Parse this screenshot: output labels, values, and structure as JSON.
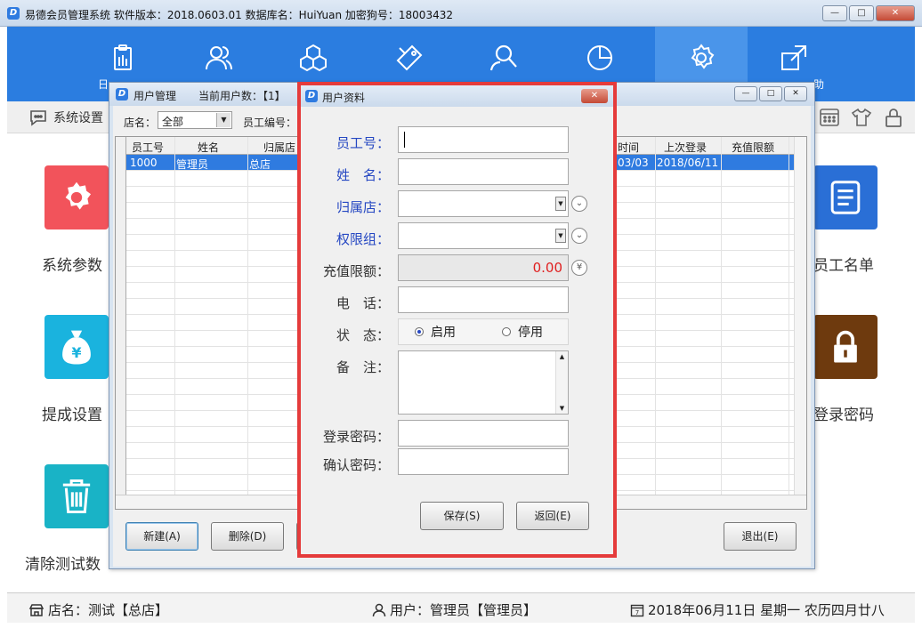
{
  "window": {
    "title": "易德会员管理系统   软件版本：2018.0603.01   数据库名：HuiYuan   加密狗号：18003432",
    "btn_min": "—",
    "btn_max": "□",
    "btn_close": "✕"
  },
  "nav": {
    "cut_label_left": "日",
    "cut_label_right": "助",
    "icons": [
      "clipboard-icon",
      "users-icon",
      "cubes-icon",
      "tag-icon",
      "search-person-icon",
      "pie-chart-icon",
      "gear-icon",
      "share-icon"
    ],
    "active_index": 6
  },
  "toolbar": {
    "system_settings": "系统设置"
  },
  "tiles": {
    "system_params": "系统参数",
    "commission": "提成设置",
    "clear_test": "清除测试数",
    "employee_list": "员工名单",
    "login_password": "登录密码",
    "colors": {
      "red": "#f2535b",
      "cyan": "#1ab3de",
      "teal": "#19b3c6",
      "blue": "#2a6fd6",
      "brown": "#6e3a0e"
    }
  },
  "status": {
    "store": "店名：测试【总店】",
    "user": "用户：管理员【管理员】",
    "date": "2018年06月11日 星期一 农历四月廿八"
  },
  "user_mgmt": {
    "title": "用户管理",
    "count": "当前用户数：【1】",
    "store_label": "店名：",
    "store_value": "全部",
    "employee_no_label": "员工编号：",
    "columns": {
      "emp_no": "员工号",
      "name": "姓名",
      "store": "归属店",
      "time": "时间",
      "last_login": "上次登录",
      "recharge_limit": "充值限额"
    },
    "row": {
      "emp_no": "1000",
      "name": "管理员",
      "store": "总店",
      "time": "03/03",
      "last_login": "2018/06/11",
      "recharge_limit": ""
    },
    "buttons": {
      "new": "新建(A)",
      "delete": "删除(D)",
      "exit": "退出(E)"
    }
  },
  "user_info": {
    "title": "用户资料",
    "labels": {
      "emp_no": "员工号：",
      "name": "姓　名：",
      "store": "归属店：",
      "permission": "权限组：",
      "limit": "充值限额：",
      "phone": "电　话：",
      "status": "状　态：",
      "remark": "备　注：",
      "login_pwd": "登录密码：",
      "confirm_pwd": "确认密码："
    },
    "values": {
      "emp_no": "",
      "name": "",
      "store": "",
      "permission": "",
      "limit": "0.00",
      "phone": "",
      "remark": "",
      "login_pwd": "",
      "confirm_pwd": ""
    },
    "status_options": {
      "enabled": "启用",
      "disabled": "停用",
      "selected": "enabled"
    },
    "buttons": {
      "save": "保存(S)",
      "back": "返回(E)"
    }
  }
}
